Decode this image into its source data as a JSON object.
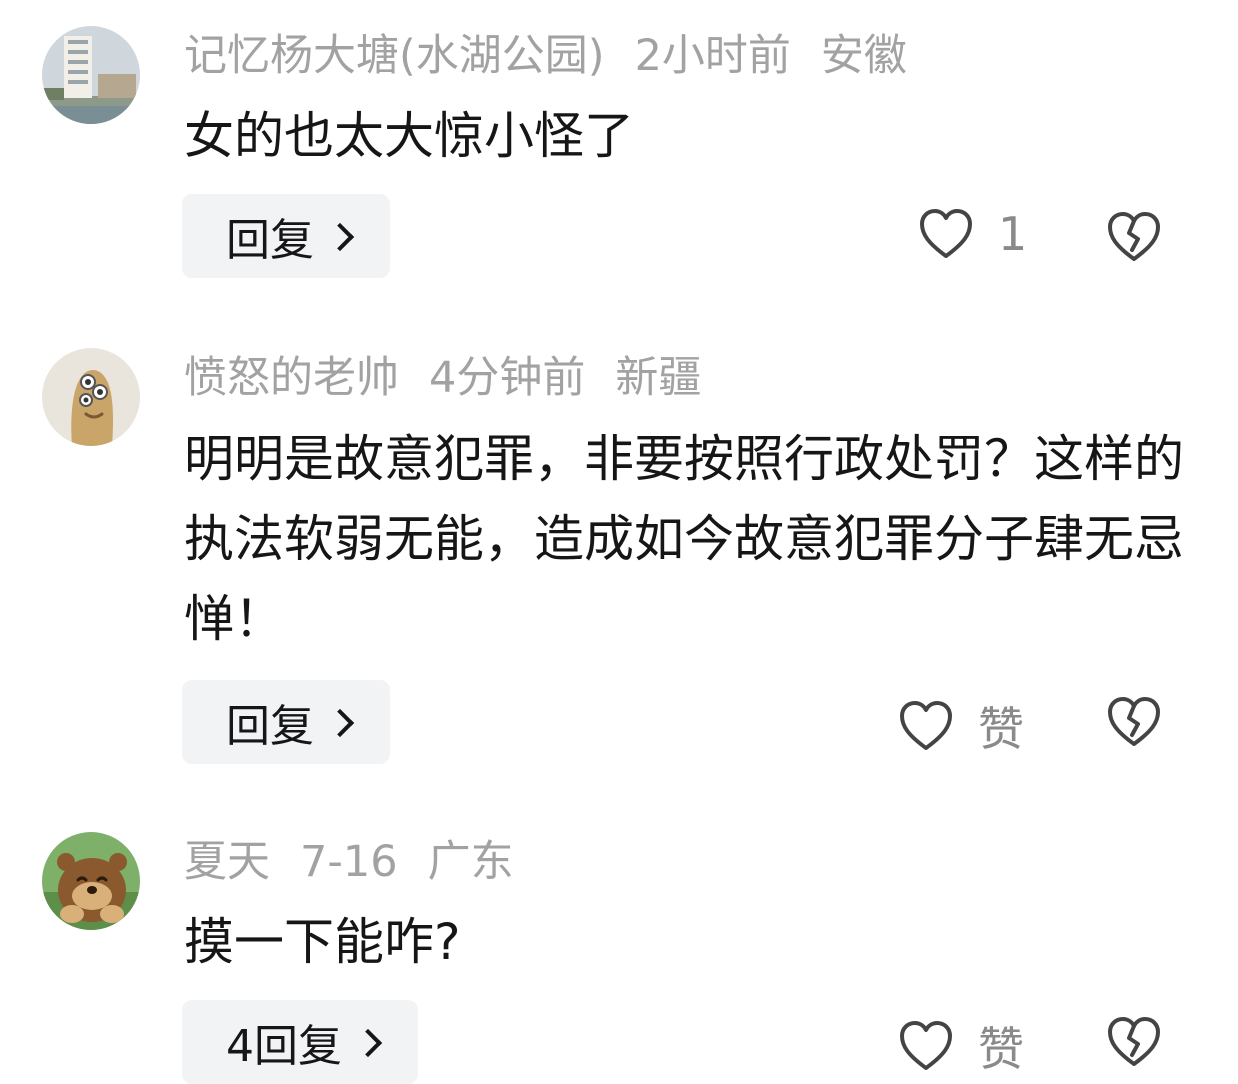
{
  "comments": [
    {
      "user": "记忆杨大塘(水湖公园)",
      "time": "2小时前",
      "location": "安徽",
      "text": "女的也太大惊小怪了",
      "reply_label": "回复",
      "like_label": "1",
      "avatar_icon": "building-lake-avatar"
    },
    {
      "user": "愤怒的老帅",
      "time": "4分钟前",
      "location": "新疆",
      "text": "明明是故意犯罪，非要按照行政处罚？这样的执法软弱无能，造成如今故意犯罪分子肆无忌惮！",
      "reply_label": "回复",
      "like_label": "赞",
      "avatar_icon": "cartoon-creature-avatar"
    },
    {
      "user": "夏天",
      "time": "7-16",
      "location": "广东",
      "text": "摸一下能咋?",
      "reply_label": "4回复",
      "like_label": "赞",
      "avatar_icon": "cartoon-bear-avatar"
    }
  ],
  "icons": {
    "like": "heart-outline-icon",
    "dislike": "broken-heart-icon",
    "reply_arrow": "chevron-right-icon"
  },
  "colors": {
    "meta_text": "#a2a2a2",
    "body_text": "#161616",
    "reply_bg": "#f2f3f5",
    "icon": "#444444"
  }
}
